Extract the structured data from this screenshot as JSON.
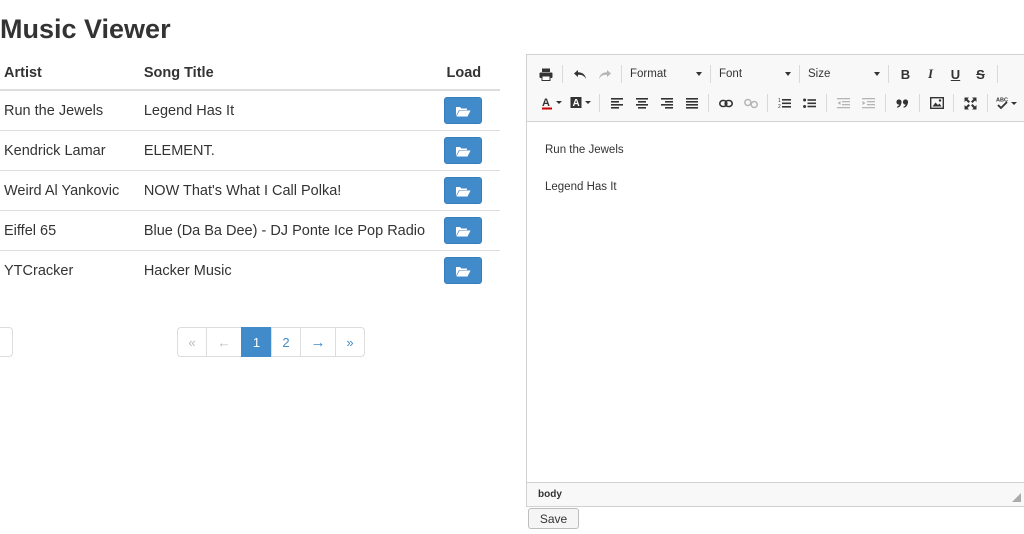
{
  "app": {
    "title": "Music Viewer"
  },
  "table": {
    "headers": {
      "artist": "Artist",
      "song": "Song Title",
      "load": "Load"
    },
    "rows": [
      {
        "artist": "Run the Jewels",
        "song": "Legend Has It"
      },
      {
        "artist": "Kendrick Lamar",
        "song": "ELEMENT."
      },
      {
        "artist": "Weird Al Yankovic",
        "song": "NOW That's What I Call Polka!"
      },
      {
        "artist": "Eiffel 65",
        "song": "Blue (Da Ba Dee) - DJ Ponte Ice Pop Radio"
      },
      {
        "artist": "YTCracker",
        "song": "Hacker Music"
      }
    ],
    "load_icon": "folder-open-icon"
  },
  "pagination": {
    "first": "«",
    "prev": "←",
    "pages": [
      "1",
      "2"
    ],
    "current_page": "1",
    "next": "→",
    "last": "»"
  },
  "editor": {
    "toolbar": {
      "format_label": "Format",
      "font_label": "Font",
      "size_label": "Size",
      "bold": "B",
      "italic": "I",
      "underline": "U",
      "strike": "S"
    },
    "content": [
      "Run the Jewels",
      "Legend Has It"
    ],
    "status_path": "body"
  },
  "save_button": "Save",
  "colors": {
    "primary": "#428bca",
    "border": "#dddddd",
    "toolbar_bg": "#f8f8f8"
  }
}
